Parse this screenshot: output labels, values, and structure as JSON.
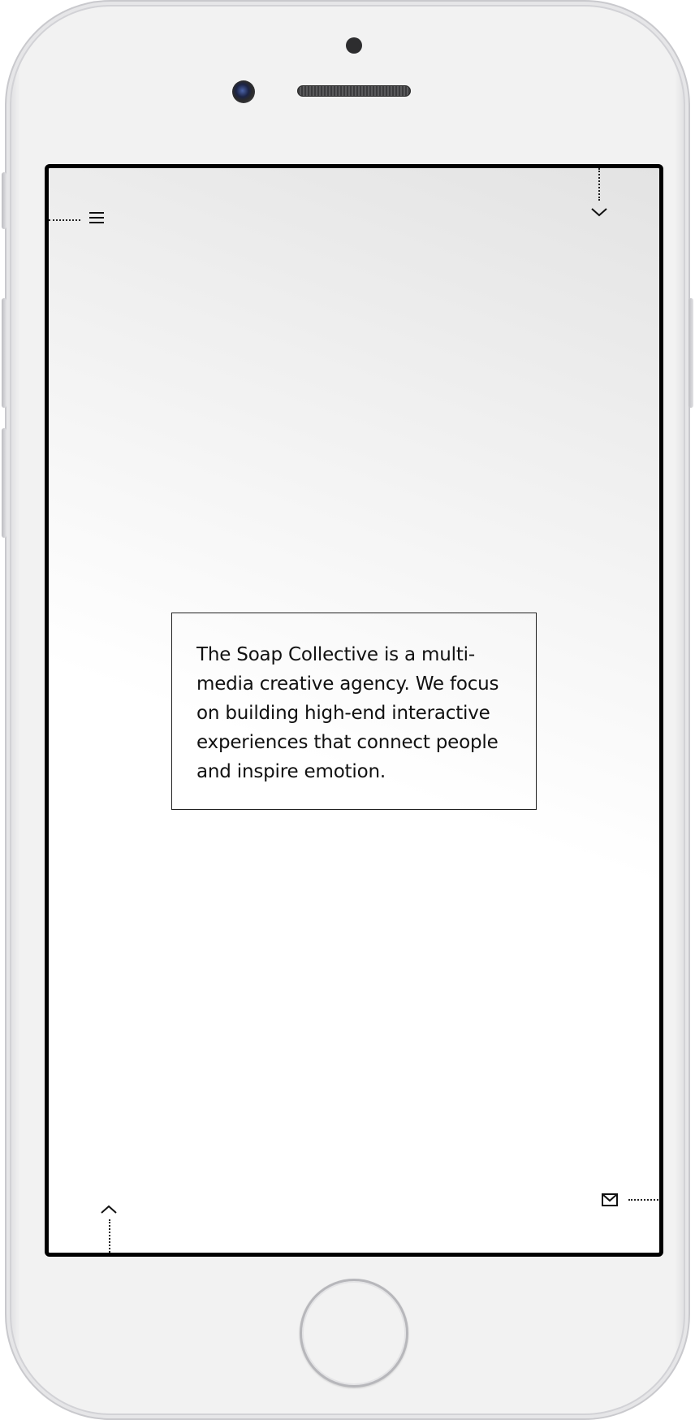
{
  "screen": {
    "about": {
      "text": "The Soap Collective is a multi-media creative agency. We focus on building high-end interactive experiences that connect people and inspire emotion."
    },
    "icons": {
      "menu": "hamburger-menu-icon",
      "scroll_down": "chevron-down-icon",
      "scroll_up": "chevron-up-icon",
      "contact": "mail-icon"
    }
  },
  "colors": {
    "frame": "#f2f2f2",
    "screen_border": "#000000",
    "text": "#111111"
  }
}
